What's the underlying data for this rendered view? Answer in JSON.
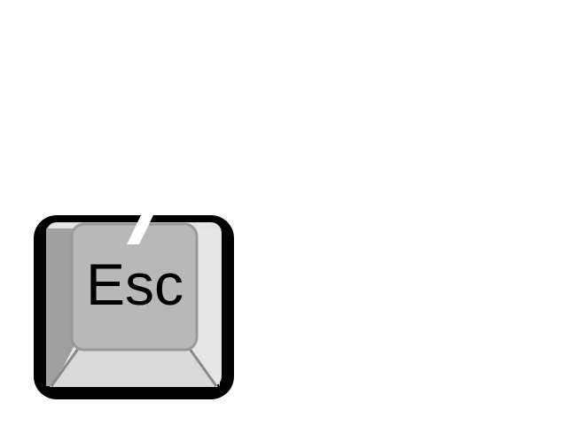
{
  "key": {
    "label": "Esc",
    "icon": "escape-key-icon"
  },
  "colors": {
    "background": "#ffffff",
    "outline": "#000000",
    "cap_top": "#b8b8b8",
    "side_left": "#a0a0a0",
    "side_right": "#e4e4e4",
    "side_bottom": "#d8d8d8",
    "highlight": "#ffffff",
    "text": "#000000"
  }
}
